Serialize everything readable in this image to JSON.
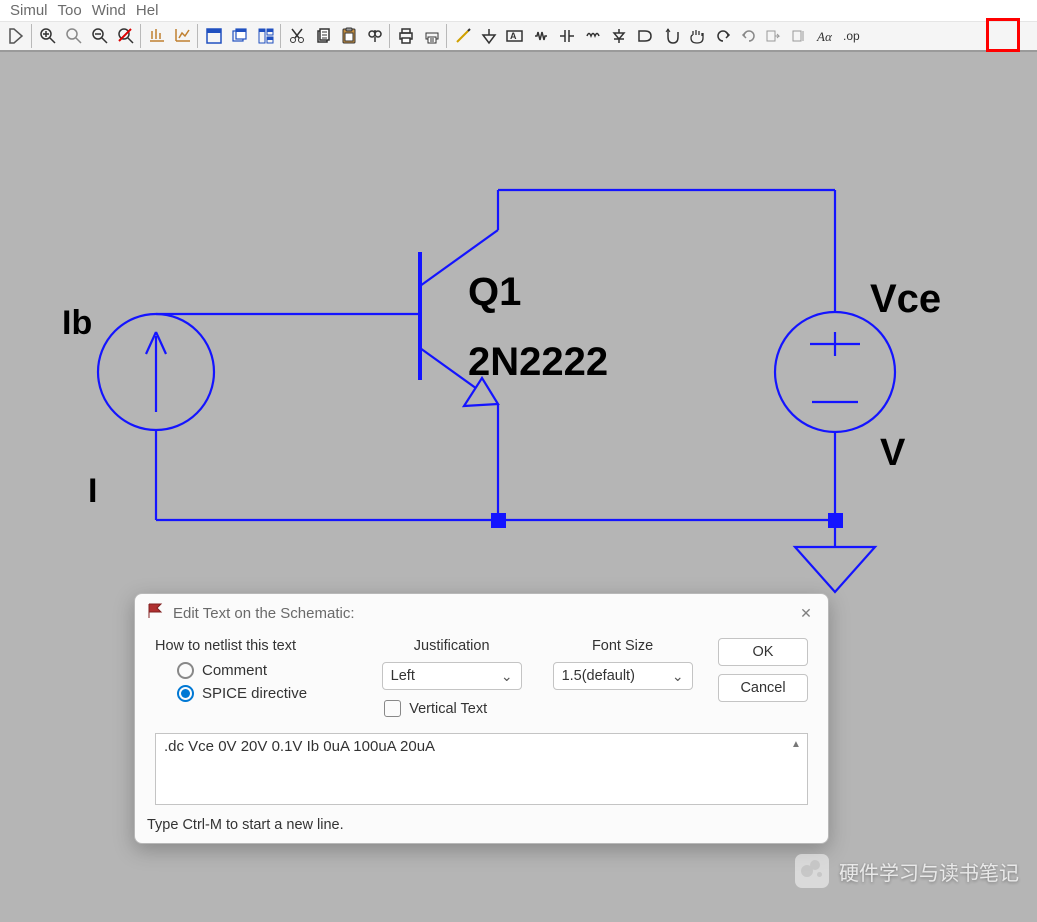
{
  "menu": {
    "items": [
      "Simul",
      "Too",
      "Wind",
      "Hel"
    ]
  },
  "toolbar": {
    "icons": [
      "run",
      "zoom-in",
      "zoom",
      "zoom-out",
      "zoom-cancel",
      "fit-x",
      "fit-xy",
      "window",
      "cascade",
      "tile",
      "cut",
      "copy",
      "paste",
      "find",
      "print",
      "print-setup",
      "pencil",
      "label",
      "component",
      "wire",
      "capacitor",
      "inductor",
      "diode",
      "gate",
      "hand-open",
      "hand-closed",
      "redo",
      "undo",
      "mirror",
      "rotate",
      "text-Aa",
      "op-directive"
    ]
  },
  "schematic": {
    "labels": {
      "Ib": "Ib",
      "I": "I",
      "Q1": "Q1",
      "part": "2N2222",
      "Vce": "Vce",
      "V": "V"
    }
  },
  "dialog": {
    "title": "Edit Text on the Schematic:",
    "groups": {
      "netlist_title": "How to netlist this text",
      "comment": "Comment",
      "spice": "SPICE directive",
      "justification_title": "Justification",
      "justification_value": "Left",
      "font_title": "Font Size",
      "font_value": "1.5(default)",
      "vertical": "Vertical Text"
    },
    "buttons": {
      "ok": "OK",
      "cancel": "Cancel"
    },
    "text_value": ".dc Vce 0V 20V 0.1V Ib 0uA 100uA 20uA",
    "footer": "Type Ctrl-M to start a new line."
  },
  "watermark": "硬件学习与读书笔记"
}
